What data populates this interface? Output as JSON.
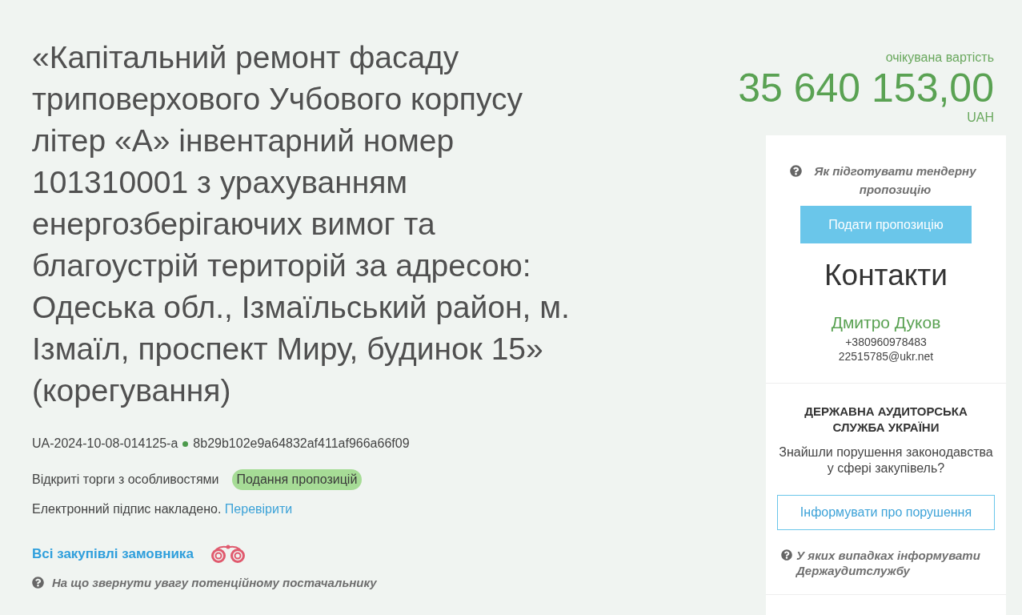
{
  "tender": {
    "title": "«Капітальний ремонт фасаду триповерхового Учбового корпусу літер «А» інвентарний номер 101310001 з урахуванням енергозберігаючих вимог та благоустрій територій за адресою: Одеська обл., Ізмаїльський район, м. Ізмаїл, проспект Миру, будинок 15» (корегування)",
    "id": "UA-2024-10-08-014125-a",
    "hash": "8b29b102e9a64832af411af966a66f09",
    "procedure": "Відкриті торги з особливостями",
    "status_badge": "Подання пропозицій",
    "signature": {
      "text": "Електронний підпис накладено.",
      "link": "Перевірити"
    },
    "buyer_link": "Всі закупівлі замовника",
    "supplier_help": "На що звернути увагу потенційному постачальнику"
  },
  "price": {
    "label": "очікувана вартість",
    "amount": "35 640 153,00",
    "currency": "UAH"
  },
  "sidebar": {
    "help_link": "Як підготувати тендерну пропозицію",
    "submit_button": "Подати пропозицію",
    "contacts": {
      "heading": "Контакти",
      "name": "Дмитро Дуков",
      "phone": "+380960978483",
      "email": "22515785@ukr.net"
    },
    "audit": {
      "heading": "ДЕРЖАВНА АУДИТОРСЬКА СЛУЖБА УКРАЇНИ",
      "question": "Знайшли порушення законодавства у сфері закупівель?",
      "button": "Інформувати про порушення",
      "help_link": "У яких випадках інформувати Держаудитслужбу"
    }
  }
}
